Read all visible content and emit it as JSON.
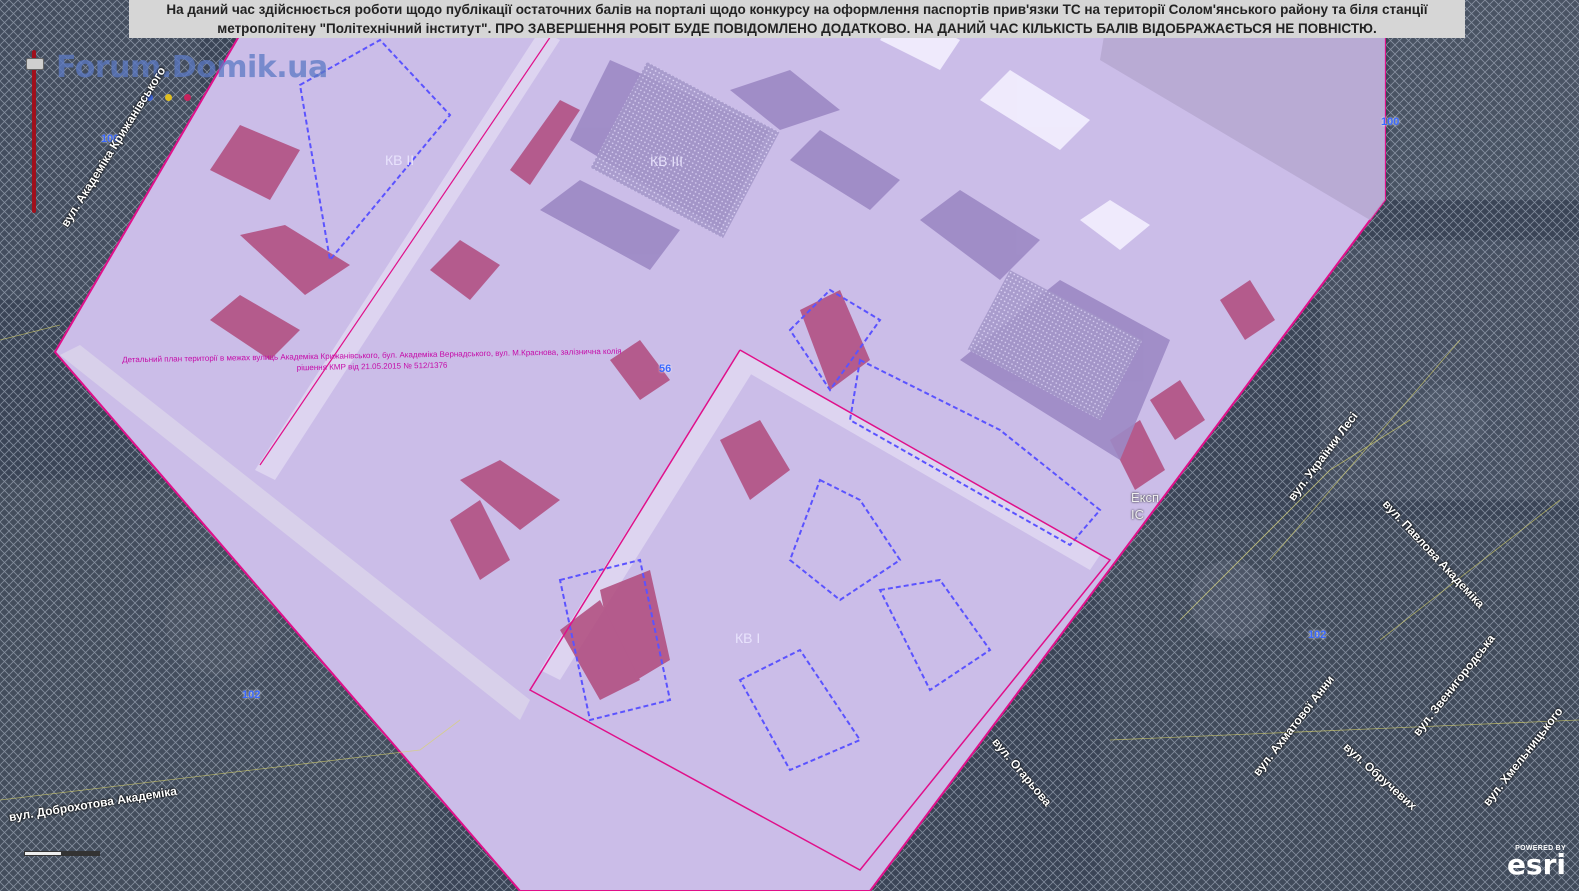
{
  "notice": {
    "line1": "На даний час здійснюється роботи щодо публікації остаточних балів на порталі щодо конкурсу на оформлення паспортів прив'язки ТС на території Солом'янського району та біля станції",
    "line2": "метрополітену \"Політехнічний інститут\". ПРО ЗАВЕРШЕННЯ РОБІТ БУДЕ ПОВІДОМЛЕНО ДОДАТКОВО. НА ДАНИЙ ЧАС КІЛЬКІСТЬ БАЛІВ ВІДОБРАЖАЄТЬСЯ НЕ ПОВНІСТЮ."
  },
  "watermark": {
    "text": "Forum.Domik.ua",
    "dot_colors": [
      "#3b62d8",
      "#e0c020",
      "#c9235d"
    ]
  },
  "plan_label": {
    "line1": "Детальний план території в межах вулиць Академіка Крижанівського, бул. Академіка Вернадського, вул. М.Краснова, залізнична колія",
    "line2": "рішення КМР від 21.05.2015 № 512/1376"
  },
  "quarters": {
    "kv2": "КВ II",
    "kv3": "КВ III",
    "kv1": "КВ І"
  },
  "block_numbers": {
    "n100_left": "100",
    "n100_right": "100",
    "n102_left": "102",
    "n102_right": "102",
    "n56": "56"
  },
  "street_labels": {
    "kryzhanivskoho": "вул. Академіка Крижанівського",
    "dobrokhotova": "вул. Доброхотова Академіка",
    "ukrainky": "вул. Українки Лесі",
    "pavlova": "вул. Павлова Академіка",
    "ohariova": "вул. Огарьова",
    "akhmatovoi": "вул. Ахматової Анни",
    "zvenyhorodska": "вул. Звенигородська",
    "obruchevykh": "вул. Обручевих",
    "khmelnytskoho": "вул. Хмельницького"
  },
  "exp_label": "Експ ІС",
  "attribution": {
    "powered_by": "POWERED BY",
    "logo": "esri"
  },
  "colors": {
    "plan_fill": "#c7b9e6",
    "building": "#b04a7c",
    "boundary": "#e0108a",
    "hatch": "#b8c4d6",
    "dashed": "#5b53ff"
  }
}
